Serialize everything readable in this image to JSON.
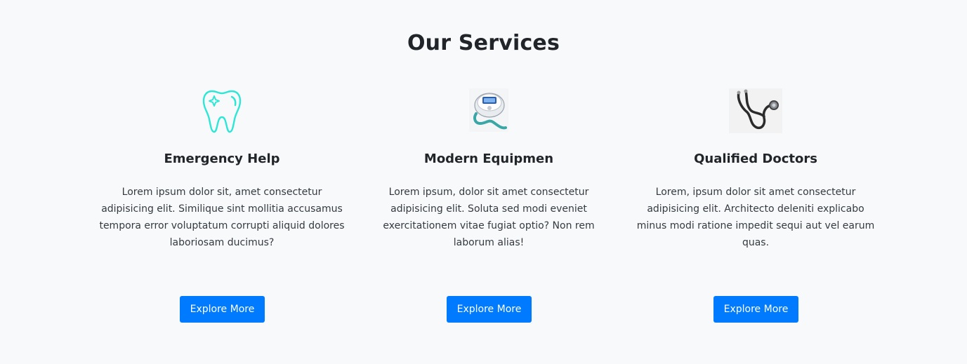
{
  "section": {
    "title": "Our Services"
  },
  "services": [
    {
      "icon": "tooth-icon",
      "title": "Emergency Help",
      "text": "Lorem ipsum dolor sit, amet consectetur adipisicing elit. Similique sint mollitia accusamus tempora error voluptatum corrupti aliquid dolores laboriosam ducimus?",
      "button_label": "Explore More"
    },
    {
      "icon": "medical-device-icon",
      "title": "Modern Equipmen",
      "text": "Lorem ipsum, dolor sit amet consectetur adipisicing elit. Soluta sed modi eveniet exercitationem vitae fugiat optio? Non rem laborum alias!",
      "button_label": "Explore More"
    },
    {
      "icon": "stethoscope-icon",
      "title": "Qualified Doctors",
      "text": "Lorem, ipsum dolor sit amet consectetur adipisicing elit. Architecto deleniti explicabo minus modi ratione impedit sequi aut vel earum quas.",
      "button_label": "Explore More"
    }
  ],
  "colors": {
    "background": "#f8f9fb",
    "button": "#007bff",
    "tooth_icon": "#2ee6d6"
  }
}
